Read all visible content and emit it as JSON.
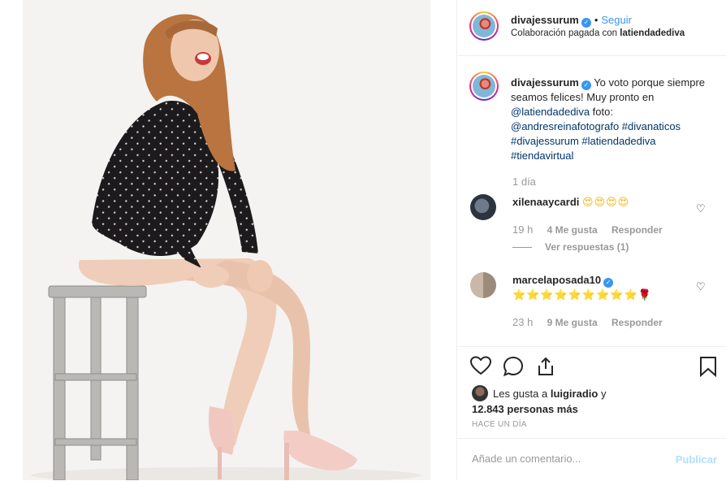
{
  "post": {
    "photo_alt": "",
    "colors": {
      "accent": "#3897f0",
      "muted": "#999999",
      "border": "#efefef"
    }
  },
  "header": {
    "username": "divajessurum",
    "dot": "•",
    "follow_label": "Seguir",
    "sub_prefix": "Colaboración pagada con",
    "sub_partner": "latiendadediva"
  },
  "caption": {
    "username": "divajessurum",
    "text_1": " Yo voto porque siempre seamos felices! Muy pronto en ",
    "mention": "@latiendadediva",
    "text_2": " foto: ",
    "tags": "@andresreinafotografo #divanaticos #divajessurum #latiendadediva #tiendavirtual",
    "time": "1 día"
  },
  "comments": [
    {
      "username": "xilenaaycardi",
      "text": "😍😍😍😍",
      "time": "19 h",
      "likes": "4 Me gusta",
      "reply": "Responder",
      "view_replies": "Ver respuestas (1)"
    },
    {
      "username": "marcelaposada10",
      "text": "⭐⭐⭐⭐⭐⭐⭐⭐⭐🌹",
      "time": "23 h",
      "likes": "9 Me gusta",
      "reply": "Responder"
    }
  ],
  "likes": {
    "prefix": "Les gusta a ",
    "user": "luigiradio",
    "suffix": " y",
    "count": "12.843 personas más"
  },
  "date": "HACE UN DÍA",
  "add_comment": {
    "placeholder": "Añade un comentario...",
    "publish_label": "Publicar"
  },
  "icons": [
    "heart-icon",
    "comment-icon",
    "share-icon",
    "bookmark-icon",
    "more-icon",
    "verified-icon"
  ]
}
